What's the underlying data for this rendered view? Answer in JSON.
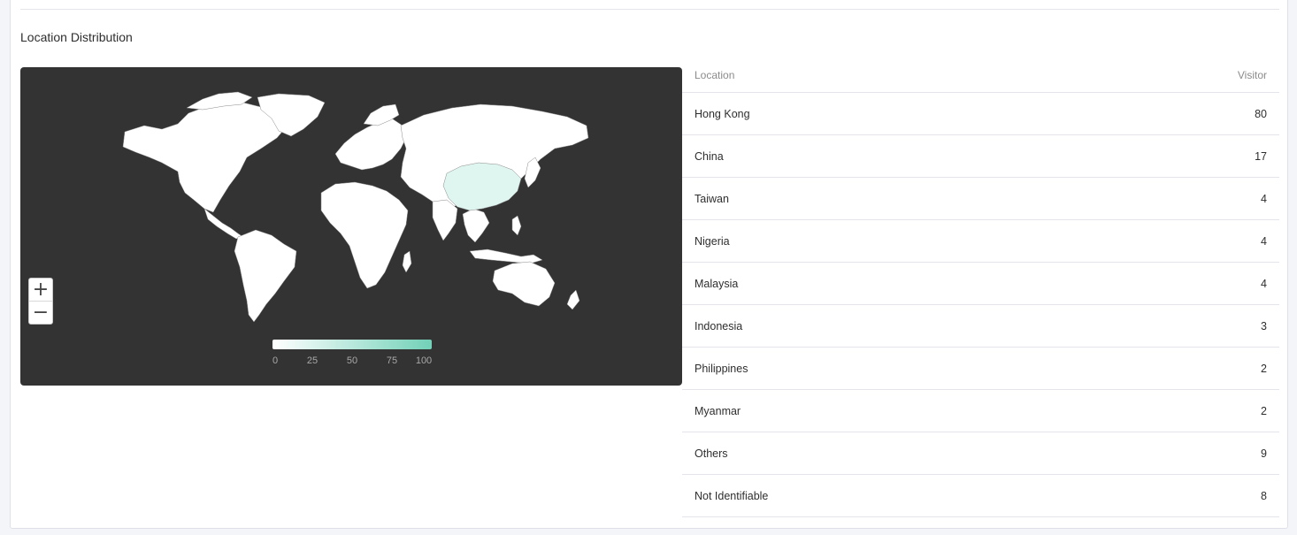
{
  "section": {
    "title": "Location Distribution"
  },
  "map": {
    "background_color": "#333333",
    "land_color": "#ffffff",
    "highlight_color": "#dff5f0",
    "scale_min_color": "#ffffff",
    "scale_max_color": "#72d1b8",
    "highlighted_country": "China",
    "zoom": {
      "in_icon": "plus-icon",
      "in_label": "+",
      "out_icon": "minus-icon",
      "out_label": "−"
    },
    "legend": {
      "ticks": [
        "0",
        "25",
        "50",
        "75",
        "100"
      ]
    }
  },
  "table": {
    "columns": {
      "location": "Location",
      "visitor": "Visitor"
    },
    "rows": [
      {
        "location": "Hong Kong",
        "visitor": "80"
      },
      {
        "location": "China",
        "visitor": "17"
      },
      {
        "location": "Taiwan",
        "visitor": "4"
      },
      {
        "location": "Nigeria",
        "visitor": "4"
      },
      {
        "location": "Malaysia",
        "visitor": "4"
      },
      {
        "location": "Indonesia",
        "visitor": "3"
      },
      {
        "location": "Philippines",
        "visitor": "2"
      },
      {
        "location": "Myanmar",
        "visitor": "2"
      },
      {
        "location": "Others",
        "visitor": "9"
      },
      {
        "location": "Not Identifiable",
        "visitor": "8"
      }
    ]
  }
}
